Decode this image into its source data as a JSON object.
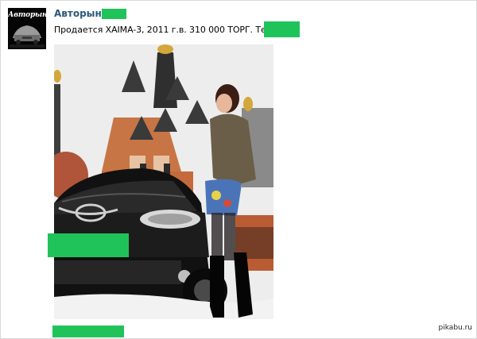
{
  "post": {
    "author": "Авторынок",
    "text": "Продается XAIMA-3, 2011 г.в. 310 000 ТОРГ. Тел:8952",
    "avatar_logo_text": "Авторынок",
    "photo_icon": "car-photo"
  },
  "watermark": "pikabu.ru",
  "colors": {
    "author_link": "#2b587a",
    "redaction": "#20c35a",
    "border": "#d9d9d9"
  }
}
